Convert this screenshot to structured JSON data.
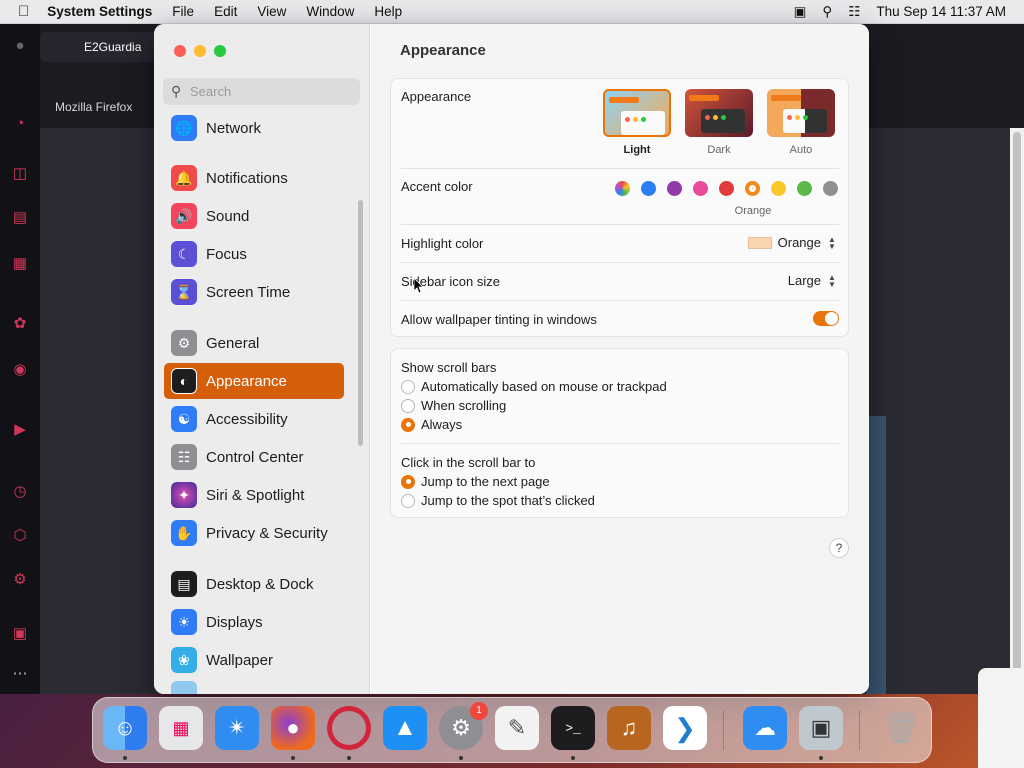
{
  "menubar": {
    "app": "System Settings",
    "menus": [
      "File",
      "Edit",
      "View",
      "Window",
      "Help"
    ],
    "datetime": "Thu Sep 14  11:37 AM"
  },
  "browser": {
    "tab_title": "E2Guardia",
    "bookmark": "Mozilla Firefox"
  },
  "sidebar": {
    "search_placeholder": "Search",
    "items": [
      {
        "label": "Network",
        "icon": "globe-icon",
        "color": "#2f7cf6"
      },
      {
        "label": "Notifications",
        "icon": "bell-icon",
        "color": "#f04b4b"
      },
      {
        "label": "Sound",
        "icon": "speaker-icon",
        "color": "#f0455a"
      },
      {
        "label": "Focus",
        "icon": "moon-icon",
        "color": "#5b4fd6"
      },
      {
        "label": "Screen Time",
        "icon": "hourglass-icon",
        "color": "#5b4fd6"
      },
      {
        "label": "General",
        "icon": "gear-icon",
        "color": "#8e8e93"
      },
      {
        "label": "Appearance",
        "icon": "appearance-icon",
        "color": "#1d1d1f"
      },
      {
        "label": "Accessibility",
        "icon": "accessibility-icon",
        "color": "#2f7cf6"
      },
      {
        "label": "Control Center",
        "icon": "toggles-icon",
        "color": "#8e8e93"
      },
      {
        "label": "Siri & Spotlight",
        "icon": "siri-icon",
        "color": "#6a3fbf"
      },
      {
        "label": "Privacy & Security",
        "icon": "hand-icon",
        "color": "#2f7cf6"
      },
      {
        "label": "Desktop & Dock",
        "icon": "dock-icon",
        "color": "#1d1d1f"
      },
      {
        "label": "Displays",
        "icon": "sun-icon",
        "color": "#2f7cf6"
      },
      {
        "label": "Wallpaper",
        "icon": "flower-icon",
        "color": "#35aee8"
      }
    ],
    "selected": "Appearance"
  },
  "main": {
    "title": "Appearance",
    "appearance": {
      "label": "Appearance",
      "options": [
        "Light",
        "Dark",
        "Auto"
      ],
      "selected": "Light"
    },
    "accent": {
      "label": "Accent color",
      "colors": [
        "#c04ecb",
        "#2b7ef5",
        "#8f3aa6",
        "#e94b9a",
        "#e03c3c",
        "#f08a1c",
        "#f6c829",
        "#5ab947",
        "#8e8e93"
      ],
      "selected_name": "Orange"
    },
    "highlight": {
      "label": "Highlight color",
      "value": "Orange",
      "swatch": "#fbd5b0"
    },
    "icon_size": {
      "label": "Sidebar icon size",
      "value": "Large"
    },
    "tinting": {
      "label": "Allow wallpaper tinting in windows",
      "enabled": true
    },
    "scroll_bars": {
      "label": "Show scroll bars",
      "options": [
        "Automatically based on mouse or trackpad",
        "When scrolling",
        "Always"
      ],
      "selected": "Always"
    },
    "click_scroll": {
      "label": "Click in the scroll bar to",
      "options": [
        "Jump to the next page",
        "Jump to the spot that’s clicked"
      ],
      "selected": "Jump to the next page"
    },
    "help": "?"
  },
  "dock": {
    "apps": [
      {
        "name": "Finder",
        "icon": "finder-icon",
        "color": "#2f8cf0"
      },
      {
        "name": "Launchpad",
        "icon": "launchpad-icon",
        "color": "#e7e7ea"
      },
      {
        "name": "Safari",
        "icon": "safari-icon",
        "color": "#2f8cf0"
      },
      {
        "name": "Firefox",
        "icon": "firefox-icon",
        "color": "#ef6a1c"
      },
      {
        "name": "Opera",
        "icon": "opera-icon",
        "color": "#d2243a"
      },
      {
        "name": "App Store",
        "icon": "appstore-icon",
        "color": "#1e90f5"
      },
      {
        "name": "System Settings",
        "icon": "settings-icon",
        "color": "#8e8e93"
      },
      {
        "name": "TextEdit",
        "icon": "textedit-icon",
        "color": "#f2f2f2"
      },
      {
        "name": "Terminal",
        "icon": "terminal-icon",
        "color": "#1d1d1f"
      },
      {
        "name": "GarageBand",
        "icon": "guitar-icon",
        "color": "#b8651f"
      },
      {
        "name": "VS Code",
        "icon": "vscode-icon",
        "color": "#1e7fd1"
      },
      {
        "name": "Weather",
        "icon": "weather-icon",
        "color": "#2f8cf0"
      },
      {
        "name": "Preview",
        "icon": "preview-icon",
        "color": "#bfc8cf"
      },
      {
        "name": "Trash",
        "icon": "trash-icon",
        "color": "#d5d5d5"
      }
    ],
    "settings_badge": "1",
    "terminal_glyph": ">_"
  }
}
